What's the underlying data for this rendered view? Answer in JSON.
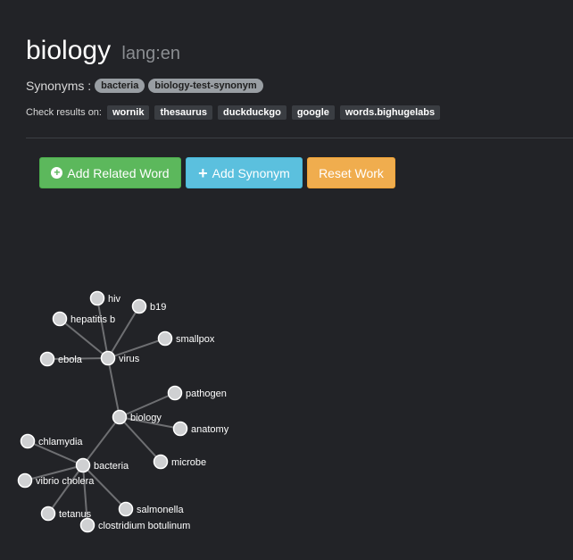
{
  "header": {
    "word": "biology",
    "lang": "lang:en"
  },
  "synonyms": {
    "label": "Synonyms :",
    "items": [
      "bacteria",
      "biology-test-synonym"
    ]
  },
  "check": {
    "label": "Check results on:",
    "sources": [
      "wornik",
      "thesaurus",
      "duckduckgo",
      "google",
      "words.bighugelabs"
    ]
  },
  "buttons": {
    "add_related": "Add Related Word",
    "add_synonym": "Add Synonym",
    "reset": "Reset Work"
  },
  "graph": {
    "node_color": "#cfd0d2",
    "edge_color": "#6e6f72",
    "nodes": [
      "hiv",
      "b19",
      "hepatitis b",
      "smallpox",
      "ebola",
      "virus",
      "pathogen",
      "biology",
      "anatomy",
      "chlamydia",
      "microbe",
      "bacteria",
      "vibrio cholera",
      "salmonella",
      "tetanus",
      "clostridium botulinum"
    ],
    "edges": [
      [
        "virus",
        "hiv"
      ],
      [
        "virus",
        "b19"
      ],
      [
        "virus",
        "hepatitis b"
      ],
      [
        "virus",
        "smallpox"
      ],
      [
        "virus",
        "ebola"
      ],
      [
        "biology",
        "virus"
      ],
      [
        "biology",
        "pathogen"
      ],
      [
        "biology",
        "anatomy"
      ],
      [
        "biology",
        "microbe"
      ],
      [
        "biology",
        "bacteria"
      ],
      [
        "bacteria",
        "chlamydia"
      ],
      [
        "bacteria",
        "vibrio cholera"
      ],
      [
        "bacteria",
        "salmonella"
      ],
      [
        "bacteria",
        "tetanus"
      ],
      [
        "bacteria",
        "clostridium botulinum"
      ]
    ]
  }
}
